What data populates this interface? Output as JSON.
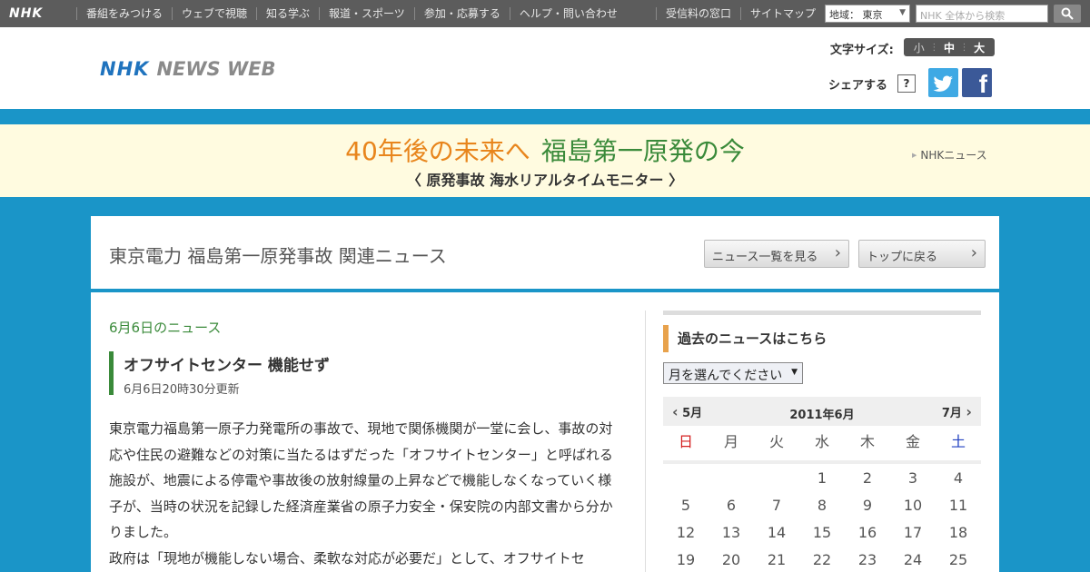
{
  "topnav": {
    "logo": "NHK",
    "links": [
      "番組をみつける",
      "ウェブで視聴",
      "知る学ぶ",
      "報道・スポーツ",
      "参加・応募する",
      "ヘルプ・問い合わせ"
    ],
    "links_right": [
      "受信料の窓口",
      "サイトマップ"
    ],
    "region_value": "地域： 東京",
    "search_placeholder": "NHK 全体から検索"
  },
  "header": {
    "brand_nhk": "NHK",
    "brand_news": "NEWS WEB",
    "font_size_label": "文字サイズ:",
    "font_size_options": [
      "小",
      "中",
      "大"
    ],
    "share_label": "シェアする",
    "share_help": "?"
  },
  "banner": {
    "title_part1": "40年後の未来へ",
    "title_part2": "福島第一原発の今",
    "subtitle": "〈 原発事故 海水リアルタイムモニター 〉",
    "crumb": "NHKニュース",
    "colors": {
      "part1": "#e8851c",
      "part2": "#3a8a3a",
      "background": "#fffbe0"
    }
  },
  "section": {
    "title": "東京電力 福島第一原発事故 関連ニュース",
    "btn_list": "ニュース一覧を見る",
    "btn_top": "トップに戻る"
  },
  "article": {
    "date_heading": "6月6日のニュース",
    "title": "オフサイトセンター 機能せず",
    "updated": "6月6日20時30分更新",
    "paragraph1": "東京電力福島第一原子力発電所の事故で、現地で関係機関が一堂に会し、事故の対応や住民の避難などの対策に当たるはずだった「オフサイトセンター」と呼ばれる施設が、地震による停電や事故後の放射線量の上昇などで機能しなくなっていく様子が、当時の状況を記録した経済産業省の原子力安全・保安院の内部文書から分かりました。",
    "paragraph2": "政府は「現地が機能しない場合、柔軟な対応が必要だ」として、オフサイトセ"
  },
  "sidebar": {
    "heading": "過去のニュースはこちら",
    "month_select": "月を選んでください",
    "calendar": {
      "prev": "5月",
      "current": "2011年6月",
      "next": "7月",
      "weekdays": [
        "日",
        "月",
        "火",
        "水",
        "木",
        "金",
        "土"
      ],
      "weeks": [
        [
          "",
          "",
          "",
          "1",
          "2",
          "3",
          "4"
        ],
        [
          "5",
          "6",
          "7",
          "8",
          "9",
          "10",
          "11"
        ],
        [
          "12",
          "13",
          "14",
          "15",
          "16",
          "17",
          "18"
        ],
        [
          "19",
          "20",
          "21",
          "22",
          "23",
          "24",
          "25"
        ]
      ]
    }
  },
  "colors": {
    "accent_blue": "#1a95c8",
    "twitter": "#3fa9e4",
    "facebook": "#3b5998"
  }
}
